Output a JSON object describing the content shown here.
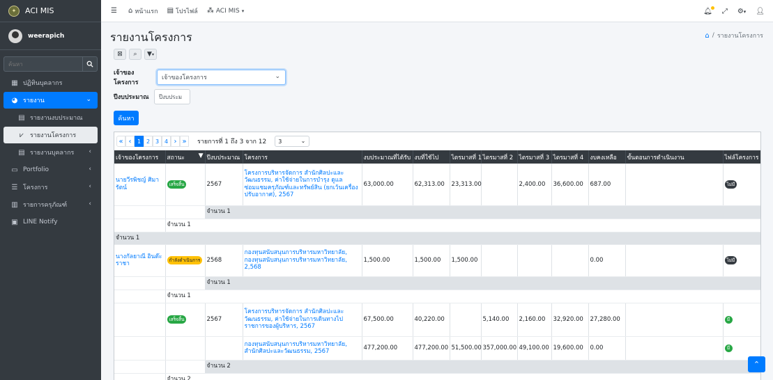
{
  "app": {
    "brand": "ACI MIS",
    "user": "weerapich"
  },
  "sidebar": {
    "search_placeholder": "ค้นหา",
    "items": [
      {
        "label": "ปฏิทินบุคลากร",
        "icon": "calendar-icon"
      },
      {
        "label": "รายงาน",
        "icon": "chart-pie-icon",
        "active": true
      },
      {
        "label": "รายงานงบประมาณ",
        "icon": "file-icon"
      },
      {
        "label": "รายงานโครงการ",
        "icon": "chart-line-icon"
      },
      {
        "label": "รายงานบุคลากร",
        "icon": "file-icon"
      },
      {
        "label": "Portfolio",
        "icon": "id-card-icon"
      },
      {
        "label": "โครงการ",
        "icon": "list-icon"
      },
      {
        "label": "รายการครุภัณฑ์",
        "icon": "table-icon"
      },
      {
        "label": "LINE Notify",
        "icon": "line-icon"
      }
    ]
  },
  "topbar": {
    "home": "หน้าแรก",
    "profile": "โปรไฟล์",
    "app_menu": "ACI MIS"
  },
  "page": {
    "title": "รายงานโครงการ",
    "breadcrumb_current": "รายงานโครงการ"
  },
  "filters": {
    "owner_label": "เจ้าของโครงการ",
    "owner_value": "เจ้าของโครงการ",
    "year_label": "ปีงบประมาณ",
    "year_placeholder": "ปีงบประม",
    "search_button": "ค้นหา"
  },
  "pager": {
    "pages": [
      "1",
      "2",
      "3",
      "4"
    ],
    "info": "รายการที่ 1 ถึง 3 จาก 12",
    "page_size": "3"
  },
  "table": {
    "headers": [
      "เจ้าของโครงการ",
      "สถานะ",
      "ปีงบประมาณ",
      "โครงการ",
      "งบประมาณที่ได้รับ",
      "งบที่ใช้ไป",
      "ไตรมาสที่ 1",
      "ไตรมาสที่ 2",
      "ไตรมาสที่ 3",
      "ไตรมาสที่ 4",
      "งบคงเหลือ",
      "ขั้นตอนการดำเนินงาน",
      "ไฟล์โครงการ"
    ],
    "owner1": "นายวีรพิชญ์ ศิมารัตน์",
    "row1": {
      "status": "เสร็จสิ้น",
      "year": "2567",
      "project": "โครงการบริหารจัดการ สำนักศิลปะและวัฒนธรรม, ค่าใช้จ่ายในการบำรุง ดูแล ซ่อมแซมครุภัณฑ์และทรัพย์สิน (ยกเว้นเครื่องปรับอากาศ), 2567",
      "budget": "63,000.00",
      "used": "62,313.00",
      "q1": "23,313.00",
      "q2": "",
      "q3": "2,400.00",
      "q4": "36,600.00",
      "remain": "687.00",
      "file": "ไม่มี"
    },
    "count_a": "จำนวน 1",
    "count_b": "จำนวน 1",
    "count_c": "จำนวน 1",
    "owner2": "นางกัลยาณี อินต๊ะราชา",
    "row2": {
      "status": "กำลังดำเนินการ",
      "year": "2568",
      "project": "กองทุนสนับสนุนการบริหารมหาวิทยาลัย, กองทุนสนับสนุนการบริหารมหาวิทยาลัย, 2,568",
      "budget": "1,500.00",
      "used": "1,500.00",
      "q1": "1,500.00",
      "remain": "0.00",
      "file": "ไม่มี"
    },
    "count_d": "จำนวน 1",
    "count_e": "จำนวน 1",
    "row3": {
      "status": "เสร็จสิ้น",
      "year": "2567",
      "project": "โครงการบริหารจัดการ สำนักศิลปะและวัฒนธรรม, ค่าใช้จ่ายในการเดินทางไปราชการของผู้บริหาร, 2567",
      "budget": "67,500.00",
      "used": "40,220.00",
      "q1": "",
      "q2": "5,140.00",
      "q3": "2,160.00",
      "q4": "32,920.00",
      "remain": "27,280.00",
      "file": "มี"
    },
    "row4": {
      "project": "กองทุนสนับสนุนการบริหารมหาวิทยาลัย, สำนักศิลปะและวัฒนธรรม, 2567",
      "budget": "477,200.00",
      "used": "477,200.00",
      "q1": "51,500.00",
      "q2": "357,000.00",
      "q3": "49,100.00",
      "q4": "19,600.00",
      "remain": "0.00",
      "file": "มี"
    },
    "count_f": "จำนวน 2",
    "count_g": "จำนวน 2"
  }
}
